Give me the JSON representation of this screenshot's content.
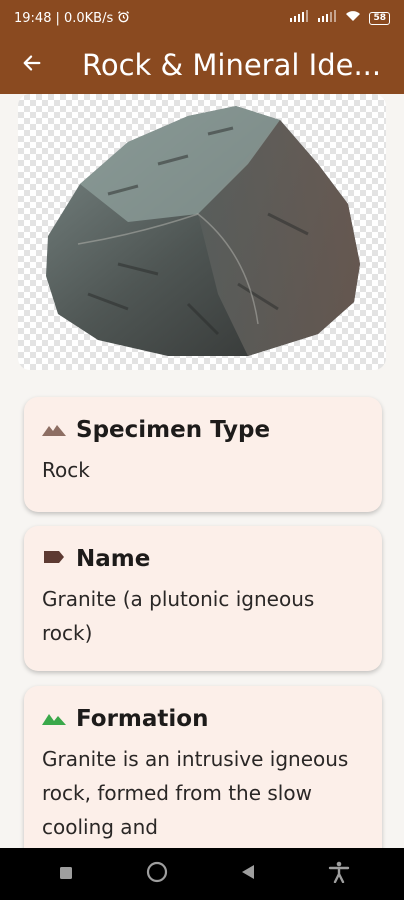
{
  "status_bar": {
    "time": "19:48",
    "network": "| 0.0KB/s",
    "battery": "58"
  },
  "app_bar": {
    "title": "Rock & Mineral Ide..."
  },
  "cards": [
    {
      "title": "Specimen Type",
      "value": "Rock",
      "icon": "mountain-icon"
    },
    {
      "title": "Name",
      "value": "Granite (a plutonic igneous rock)",
      "icon": "label-tag-icon"
    },
    {
      "title": "Formation",
      "value": "Granite is an intrusive igneous rock, formed from the slow cooling and",
      "icon": "terrain-icon"
    }
  ],
  "colors": {
    "app_bar": "#8a4a20",
    "card_background": "#fcefe9",
    "formation_icon": "#3aa84a",
    "specimen_icon": "#8d6e63",
    "name_icon": "#5d3a32"
  }
}
